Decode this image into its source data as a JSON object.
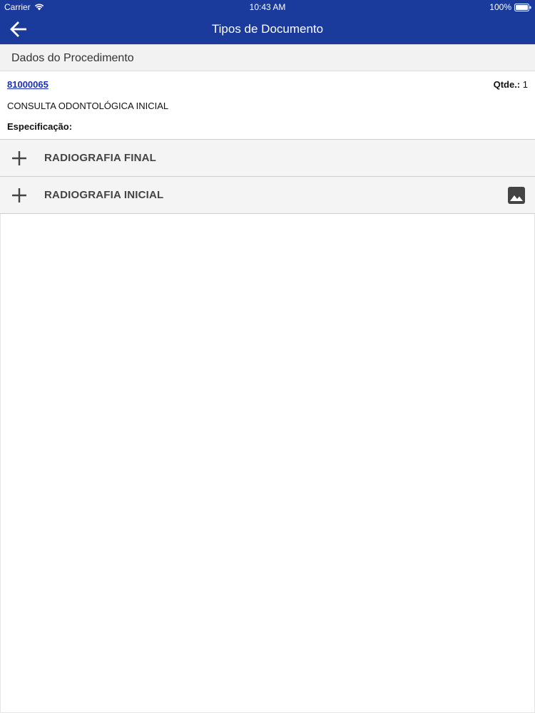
{
  "status_bar": {
    "carrier": "Carrier",
    "time": "10:43 AM",
    "battery": "100%"
  },
  "nav": {
    "title": "Tipos de Documento",
    "back_icon": "arrow-left-icon"
  },
  "section": {
    "title": "Dados do Procedimento"
  },
  "procedure": {
    "code": "81000065",
    "qty_label": "Qtde.:",
    "qty_value": "1",
    "name": "CONSULTA ODONTOLÓGICA INICIAL",
    "spec_label": "Especificação:"
  },
  "documents": [
    {
      "label": "RADIOGRAFIA FINAL",
      "icon": "plus-icon",
      "has_image": false
    },
    {
      "label": "RADIOGRAFIA INICIAL",
      "icon": "plus-icon",
      "has_image": true
    }
  ],
  "colors": {
    "header": "#1a3a9c",
    "link": "#1a2fb8",
    "row_background": "#f4f4f4"
  }
}
